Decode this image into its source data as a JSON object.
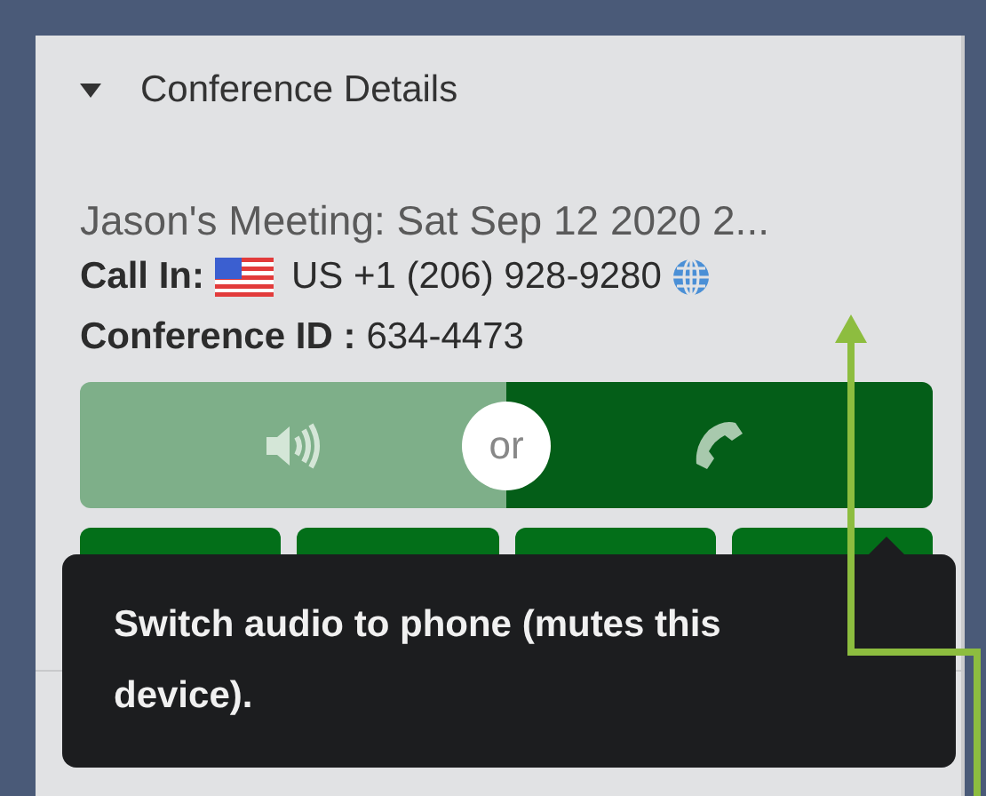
{
  "section": {
    "title": "Conference Details",
    "expanded": true
  },
  "meeting_title": "Jason's Meeting: Sat Sep 12 2020 2...",
  "call_in": {
    "label": "Call In:",
    "number": "US +1 (206) 928-9280"
  },
  "conference_id": {
    "label": "Conference ID :",
    "value": "634-4473"
  },
  "audio_toggle": {
    "separator": "or",
    "options": [
      {
        "kind": "speaker",
        "selected": false
      },
      {
        "kind": "phone",
        "selected": true
      }
    ]
  },
  "tooltip": "Switch audio to phone (mutes this device)."
}
